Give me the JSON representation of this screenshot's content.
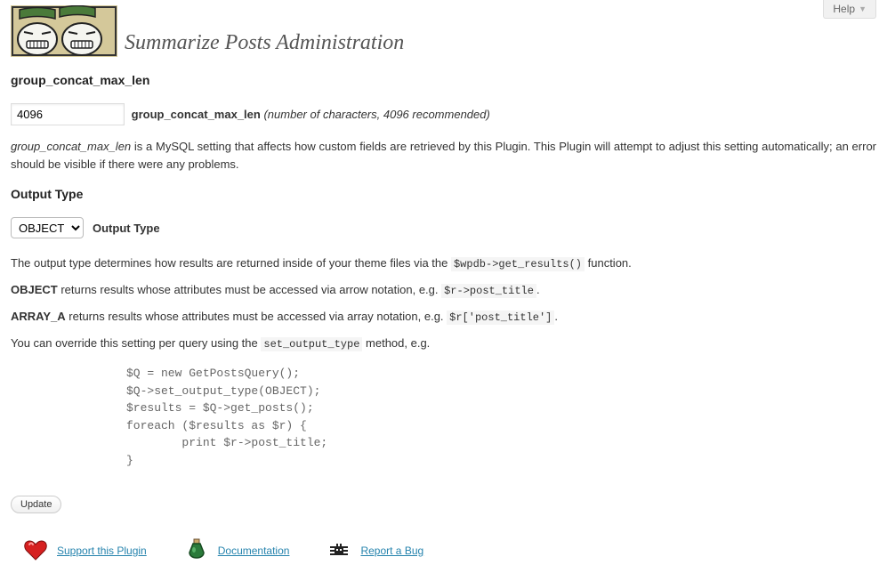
{
  "help": {
    "label": "Help"
  },
  "header": {
    "title": "Summarize Posts Administration"
  },
  "section1": {
    "title": "group_concat_max_len",
    "input_value": "4096",
    "label": "group_concat_max_len",
    "hint": "(number of characters, 4096 recommended)",
    "desc_em": "group_concat_max_len",
    "desc_text": " is a MySQL setting that affects how custom fields are retrieved by this Plugin. This Plugin will attempt to adjust this setting automatically; an error should be visible if there were any problems."
  },
  "section2": {
    "title": "Output Type",
    "select_value": "OBJECT",
    "select_label": "Output Type",
    "p1_a": "The output type determines how results are returned inside of your theme files via the ",
    "p1_code": "$wpdb->get_results()",
    "p1_b": " function.",
    "p2_strong": "OBJECT",
    "p2_a": " returns results whose attributes must be accessed via arrow notation, e.g. ",
    "p2_code": "$r->post_title",
    "p2_b": ".",
    "p3_strong": "ARRAY_A",
    "p3_a": " returns results whose attributes must be accessed via array notation, e.g. ",
    "p3_code": "$r['post_title']",
    "p3_b": ".",
    "p4_a": "You can override this setting per query using the ",
    "p4_code": "set_output_type",
    "p4_b": " method, e.g.",
    "code_block": "$Q = new GetPostsQuery();\n$Q->set_output_type(OBJECT);\n$results = $Q->get_posts();\nforeach ($results as $r) {\n        print $r->post_title;\n}"
  },
  "buttons": {
    "update": "Update"
  },
  "footer": {
    "support": "Support this Plugin",
    "docs": "Documentation",
    "bug": "Report a Bug"
  }
}
